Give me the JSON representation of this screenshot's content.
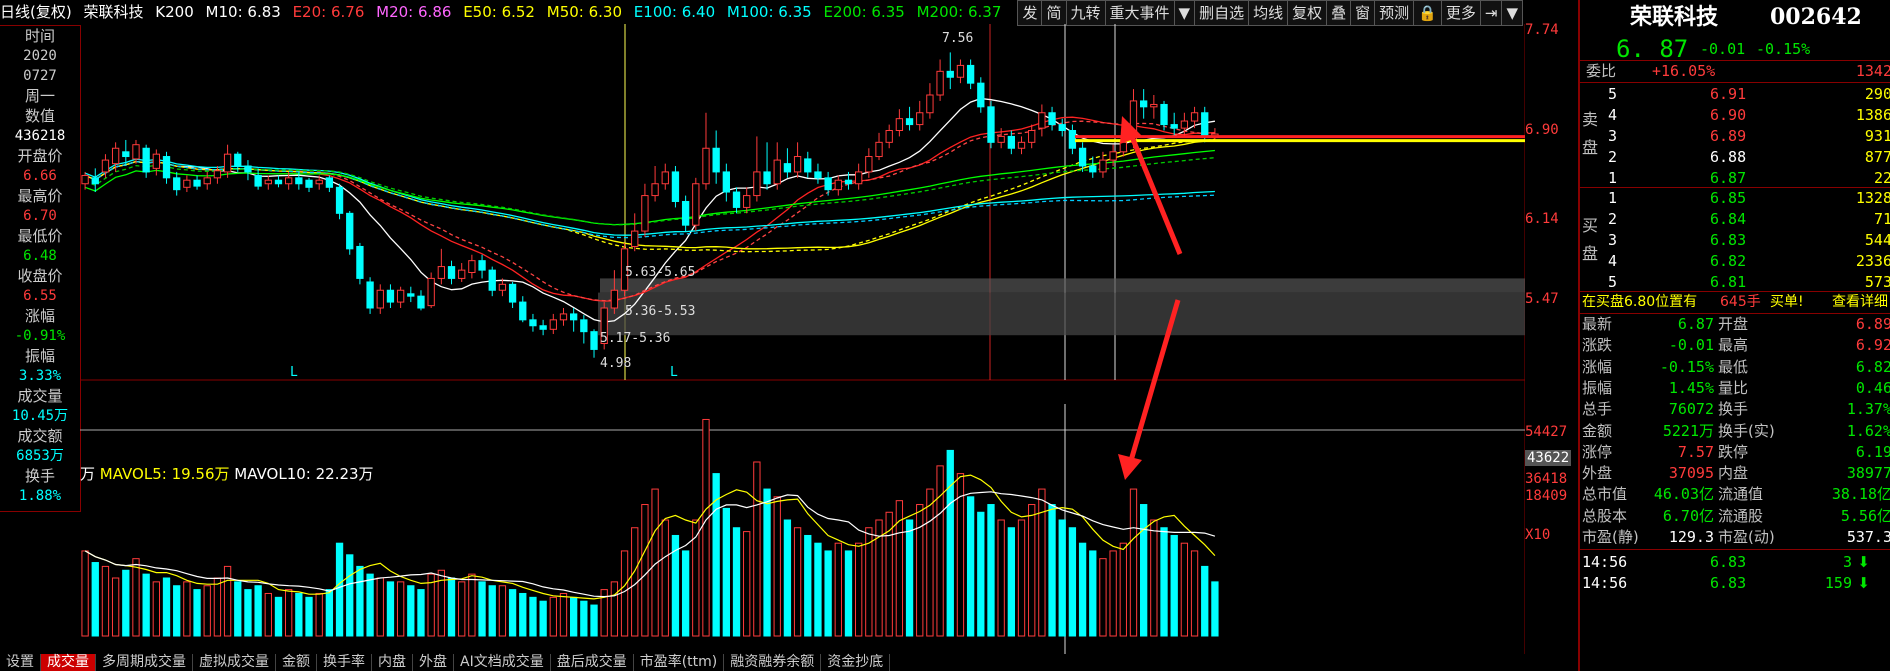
{
  "legend": {
    "title": "日线(复权)",
    "stock": "荣联科技",
    "k200": "K200",
    "m10": "M10: 6.83",
    "e20": "E20: 6.76",
    "m20": "M20: 6.86",
    "e50": "E50: 6.52",
    "m50": "M50: 6.30",
    "e100": "E100: 6.40",
    "m100": "M100: 6.35",
    "e200": "E200: 6.35",
    "m200": "M200: 6.37"
  },
  "toolbar": [
    "发",
    "简",
    "九转",
    "重大事件",
    "▼",
    "删自选",
    "均线",
    "复权",
    "叠",
    "窗",
    "预测",
    "🔒",
    "更多",
    "⇥",
    "▼"
  ],
  "left_panel": [
    {
      "label": "时间",
      "value": "2020"
    },
    {
      "label": "",
      "value": "0727"
    },
    {
      "label": "周一",
      "value": ""
    },
    {
      "label": "数值",
      "value": "436218"
    },
    {
      "label": "开盘价",
      "value": "6.66"
    },
    {
      "label": "最高价",
      "value": "6.70"
    },
    {
      "label": "最低价",
      "value": "6.48"
    },
    {
      "label": "收盘价",
      "value": "6.55"
    },
    {
      "label": "涨幅",
      "value": "-0.91%"
    },
    {
      "label": "振幅",
      "value": "3.33%"
    },
    {
      "label": "成交量",
      "value": "10.45万"
    },
    {
      "label": "成交额",
      "value": "6853万"
    },
    {
      "label": "换手",
      "value": "1.88%"
    }
  ],
  "price_scale": [
    "7.74",
    "6.90",
    "6.14",
    "5.47"
  ],
  "volume_scale": [
    "54427",
    "43622",
    "36418",
    "18409",
    "X10"
  ],
  "annotations": {
    "high": "7.56",
    "low": "4.98",
    "box1": "5.63-5.65",
    "box2": "5.36-5.53",
    "box3": "5.17-5.36",
    "l1": "L",
    "l2": "L"
  },
  "volume_legend": {
    "unit": "万",
    "mavol5": "MAVOL5: 19.56万",
    "mavol10": "MAVOL10: 22.23万"
  },
  "quote": {
    "name": "荣联科技",
    "code": "002642",
    "price": "6. 87",
    "change": "-0.01",
    "pct": "-0.15%",
    "weibi_label": "委比",
    "weibi_value": "+16.05%",
    "weibi_right": "1342",
    "sell_label_1": "卖",
    "sell_label_2": "盘",
    "buy_label_1": "买",
    "buy_label_2": "盘",
    "sells": [
      {
        "n": "5",
        "p": "6.91",
        "v": "290"
      },
      {
        "n": "4",
        "p": "6.90",
        "v": "1386"
      },
      {
        "n": "3",
        "p": "6.89",
        "v": "931"
      },
      {
        "n": "2",
        "p": "6.88",
        "v": "877"
      },
      {
        "n": "1",
        "p": "6.87",
        "v": "22"
      }
    ],
    "buys": [
      {
        "n": "1",
        "p": "6.85",
        "v": "1328"
      },
      {
        "n": "2",
        "p": "6.84",
        "v": "71"
      },
      {
        "n": "3",
        "p": "6.83",
        "v": "544"
      },
      {
        "n": "4",
        "p": "6.82",
        "v": "2336"
      },
      {
        "n": "5",
        "p": "6.81",
        "v": "573"
      }
    ],
    "notice_pre": "在买盘6.80位置有",
    "notice_amt": "645手",
    "notice_post": "买单!",
    "notice_link": "查看详细",
    "stats": [
      {
        "l": "最新",
        "v": "6.87",
        "l2": "开盘",
        "v2": "6.89"
      },
      {
        "l": "涨跌",
        "v": "-0.01",
        "l2": "最高",
        "v2": "6.92"
      },
      {
        "l": "涨幅",
        "v": "-0.15%",
        "l2": "最低",
        "v2": "6.82"
      },
      {
        "l": "振幅",
        "v": "1.45%",
        "l2": "量比",
        "v2": "0.46"
      },
      {
        "l": "总手",
        "v": "76072",
        "l2": "换手",
        "v2": "1.37%"
      },
      {
        "l": "金额",
        "v": "5221万",
        "l2": "换手(实)",
        "v2": "1.62%"
      },
      {
        "l": "涨停",
        "v": "7.57",
        "l2": "跌停",
        "v2": "6.19"
      },
      {
        "l": "外盘",
        "v": "37095",
        "l2": "内盘",
        "v2": "38977"
      },
      {
        "l": "总市值",
        "v": "46.03亿",
        "l2": "流通值",
        "v2": "38.18亿"
      },
      {
        "l": "总股本",
        "v": "6.70亿",
        "l2": "流通股",
        "v2": "5.56亿"
      },
      {
        "l": "市盈(静)",
        "v": "129.3",
        "l2": "市盈(动)",
        "v2": "537.3"
      }
    ],
    "ticks": [
      {
        "t": "14:56",
        "p": "6.83",
        "v": "3"
      },
      {
        "t": "14:56",
        "p": "6.83",
        "v": "159"
      }
    ]
  },
  "bottom_tabs": [
    "设置",
    "成交量",
    "多周期成交量",
    "虚拟成交量",
    "金额",
    "换手率",
    "内盘",
    "外盘",
    "AI文档成交量",
    "盘后成交量",
    "市盈率(ttm)",
    "融资融券余额",
    "资金抄底"
  ],
  "chart_data": {
    "type": "candlestick",
    "ylim": [
      4.8,
      7.8
    ],
    "candles": [
      [
        6.45,
        6.52,
        6.4,
        6.55
      ],
      [
        6.5,
        6.45,
        6.38,
        6.58
      ],
      [
        6.55,
        6.65,
        6.5,
        6.7
      ],
      [
        6.62,
        6.75,
        6.55,
        6.8
      ],
      [
        6.72,
        6.68,
        6.6,
        6.82
      ],
      [
        6.66,
        6.78,
        6.62,
        6.82
      ],
      [
        6.75,
        6.55,
        6.5,
        6.78
      ],
      [
        6.58,
        6.7,
        6.52,
        6.74
      ],
      [
        6.68,
        6.5,
        6.45,
        6.72
      ],
      [
        6.5,
        6.4,
        6.35,
        6.55
      ],
      [
        6.42,
        6.48,
        6.38,
        6.52
      ],
      [
        6.48,
        6.43,
        6.4,
        6.52
      ],
      [
        6.45,
        6.5,
        6.4,
        6.55
      ],
      [
        6.5,
        6.56,
        6.45,
        6.6
      ],
      [
        6.55,
        6.7,
        6.5,
        6.78
      ],
      [
        6.7,
        6.6,
        6.55,
        6.72
      ],
      [
        6.6,
        6.55,
        6.48,
        6.65
      ],
      [
        6.52,
        6.43,
        6.4,
        6.58
      ],
      [
        6.45,
        6.48,
        6.4,
        6.52
      ],
      [
        6.48,
        6.45,
        6.42,
        6.52
      ],
      [
        6.45,
        6.5,
        6.4,
        6.55
      ],
      [
        6.5,
        6.45,
        6.4,
        6.55
      ],
      [
        6.48,
        6.42,
        6.38,
        6.5
      ],
      [
        6.45,
        6.48,
        6.4,
        6.52
      ],
      [
        6.5,
        6.42,
        6.38,
        6.52
      ],
      [
        6.42,
        6.2,
        6.15,
        6.45
      ],
      [
        6.2,
        5.9,
        5.85,
        6.22
      ],
      [
        5.92,
        5.65,
        5.6,
        5.95
      ],
      [
        5.62,
        5.4,
        5.35,
        5.66
      ],
      [
        5.4,
        5.55,
        5.35,
        5.6
      ],
      [
        5.55,
        5.45,
        5.4,
        5.6
      ],
      [
        5.45,
        5.55,
        5.4,
        5.58
      ],
      [
        5.52,
        5.5,
        5.45,
        5.58
      ],
      [
        5.5,
        5.4,
        5.38,
        5.55
      ],
      [
        5.42,
        5.65,
        5.4,
        5.7
      ],
      [
        5.65,
        5.75,
        5.6,
        5.9
      ],
      [
        5.75,
        5.65,
        5.6,
        5.8
      ],
      [
        5.65,
        5.72,
        5.62,
        5.78
      ],
      [
        5.7,
        5.8,
        5.65,
        5.85
      ],
      [
        5.8,
        5.72,
        5.65,
        5.85
      ],
      [
        5.72,
        5.55,
        5.5,
        5.75
      ],
      [
        5.55,
        5.6,
        5.5,
        5.65
      ],
      [
        5.6,
        5.45,
        5.4,
        5.62
      ],
      [
        5.45,
        5.3,
        5.28,
        5.5
      ],
      [
        5.3,
        5.25,
        5.2,
        5.35
      ],
      [
        5.25,
        5.22,
        5.17,
        5.3
      ],
      [
        5.22,
        5.3,
        5.18,
        5.35
      ],
      [
        5.3,
        5.35,
        5.25,
        5.4
      ],
      [
        5.35,
        5.3,
        5.2,
        5.4
      ],
      [
        5.3,
        5.2,
        5.1,
        5.34
      ],
      [
        5.2,
        5.05,
        4.98,
        5.22
      ],
      [
        5.1,
        5.4,
        5.05,
        5.45
      ],
      [
        5.4,
        5.55,
        5.35,
        5.72
      ],
      [
        5.55,
        5.9,
        5.5,
        5.95
      ],
      [
        5.92,
        6.05,
        5.88,
        6.2
      ],
      [
        6.05,
        6.35,
        6.0,
        6.45
      ],
      [
        6.35,
        6.45,
        6.3,
        6.6
      ],
      [
        6.45,
        6.55,
        6.4,
        6.62
      ],
      [
        6.55,
        6.3,
        6.25,
        6.6
      ],
      [
        6.3,
        6.1,
        6.05,
        6.35
      ],
      [
        6.1,
        6.45,
        6.05,
        6.5
      ],
      [
        6.45,
        6.75,
        6.4,
        7.05
      ],
      [
        6.75,
        6.55,
        6.45,
        6.9
      ],
      [
        6.55,
        6.38,
        6.3,
        6.62
      ],
      [
        6.38,
        6.25,
        6.2,
        6.42
      ],
      [
        6.25,
        6.35,
        6.2,
        6.42
      ],
      [
        6.35,
        6.55,
        6.3,
        6.85
      ],
      [
        6.55,
        6.45,
        6.4,
        6.8
      ],
      [
        6.45,
        6.65,
        6.4,
        6.8
      ],
      [
        6.62,
        6.55,
        6.5,
        6.75
      ],
      [
        6.55,
        6.68,
        6.5,
        6.8
      ],
      [
        6.66,
        6.55,
        6.5,
        6.72
      ],
      [
        6.55,
        6.5,
        6.45,
        6.62
      ],
      [
        6.5,
        6.4,
        6.35,
        6.55
      ],
      [
        6.4,
        6.48,
        6.35,
        6.52
      ],
      [
        6.48,
        6.45,
        6.4,
        6.55
      ],
      [
        6.45,
        6.55,
        6.4,
        6.62
      ],
      [
        6.55,
        6.68,
        6.5,
        6.75
      ],
      [
        6.68,
        6.8,
        6.65,
        6.88
      ],
      [
        6.8,
        6.9,
        6.75,
        6.95
      ],
      [
        6.9,
        7.0,
        6.85,
        7.08
      ],
      [
        7.0,
        6.95,
        6.9,
        7.1
      ],
      [
        6.95,
        7.05,
        6.9,
        7.15
      ],
      [
        7.05,
        7.2,
        7.0,
        7.3
      ],
      [
        7.2,
        7.4,
        7.15,
        7.5
      ],
      [
        7.4,
        7.35,
        7.25,
        7.56
      ],
      [
        7.35,
        7.45,
        7.3,
        7.5
      ],
      [
        7.45,
        7.3,
        7.25,
        7.5
      ],
      [
        7.3,
        7.1,
        7.05,
        7.35
      ],
      [
        7.1,
        6.8,
        6.75,
        7.15
      ],
      [
        6.8,
        6.85,
        6.75,
        6.92
      ],
      [
        6.85,
        6.75,
        6.7,
        6.9
      ],
      [
        6.75,
        6.8,
        6.7,
        6.85
      ],
      [
        6.8,
        6.9,
        6.75,
        6.95
      ],
      [
        6.92,
        7.05,
        6.85,
        7.12
      ],
      [
        7.05,
        6.95,
        6.9,
        7.1
      ],
      [
        6.95,
        6.9,
        6.85,
        7.0
      ],
      [
        6.9,
        6.75,
        6.7,
        6.95
      ],
      [
        6.75,
        6.6,
        6.55,
        6.8
      ],
      [
        6.6,
        6.55,
        6.5,
        6.68
      ],
      [
        6.55,
        6.65,
        6.5,
        6.72
      ],
      [
        6.65,
        6.72,
        6.6,
        6.78
      ],
      [
        6.72,
        6.8,
        6.68,
        6.85
      ],
      [
        6.8,
        7.15,
        6.75,
        7.25
      ],
      [
        7.15,
        7.1,
        7.0,
        7.25
      ],
      [
        7.1,
        7.12,
        7.0,
        7.2
      ],
      [
        7.12,
        6.95,
        6.9,
        7.15
      ],
      [
        6.95,
        6.92,
        6.85,
        7.05
      ],
      [
        6.92,
        6.98,
        6.85,
        7.05
      ],
      [
        6.98,
        7.05,
        6.92,
        7.1
      ],
      [
        7.05,
        6.85,
        6.8,
        7.1
      ],
      [
        6.85,
        6.87,
        6.82,
        6.92
      ]
    ],
    "volumes": [
      [
        22,
        1
      ],
      [
        19,
        0
      ],
      [
        18,
        1
      ],
      [
        15,
        1
      ],
      [
        17,
        0
      ],
      [
        20,
        1
      ],
      [
        16,
        0
      ],
      [
        14,
        1
      ],
      [
        15,
        0
      ],
      [
        13,
        0
      ],
      [
        14,
        1
      ],
      [
        12,
        0
      ],
      [
        13,
        1
      ],
      [
        15,
        1
      ],
      [
        18,
        1
      ],
      [
        14,
        0
      ],
      [
        12,
        0
      ],
      [
        13,
        0
      ],
      [
        11,
        1
      ],
      [
        10,
        0
      ],
      [
        12,
        1
      ],
      [
        11,
        0
      ],
      [
        10,
        0
      ],
      [
        11,
        1
      ],
      [
        12,
        0
      ],
      [
        24,
        0
      ],
      [
        21,
        0
      ],
      [
        18,
        0
      ],
      [
        16,
        0
      ],
      [
        15,
        1
      ],
      [
        14,
        0
      ],
      [
        14,
        1
      ],
      [
        13,
        0
      ],
      [
        12,
        0
      ],
      [
        16,
        1
      ],
      [
        17,
        1
      ],
      [
        15,
        0
      ],
      [
        14,
        1
      ],
      [
        16,
        1
      ],
      [
        14,
        0
      ],
      [
        13,
        0
      ],
      [
        13,
        1
      ],
      [
        12,
        0
      ],
      [
        11,
        0
      ],
      [
        10,
        0
      ],
      [
        9,
        0
      ],
      [
        10,
        1
      ],
      [
        11,
        1
      ],
      [
        10,
        0
      ],
      [
        9,
        0
      ],
      [
        8,
        0
      ],
      [
        12,
        1
      ],
      [
        14,
        1
      ],
      [
        22,
        1
      ],
      [
        28,
        1
      ],
      [
        34,
        1
      ],
      [
        38,
        1
      ],
      [
        30,
        1
      ],
      [
        26,
        0
      ],
      [
        22,
        0
      ],
      [
        30,
        1
      ],
      [
        56,
        1
      ],
      [
        42,
        0
      ],
      [
        33,
        0
      ],
      [
        28,
        0
      ],
      [
        27,
        1
      ],
      [
        45,
        1
      ],
      [
        38,
        0
      ],
      [
        36,
        1
      ],
      [
        30,
        0
      ],
      [
        28,
        1
      ],
      [
        26,
        0
      ],
      [
        24,
        0
      ],
      [
        22,
        0
      ],
      [
        24,
        1
      ],
      [
        22,
        0
      ],
      [
        24,
        1
      ],
      [
        28,
        1
      ],
      [
        30,
        1
      ],
      [
        32,
        1
      ],
      [
        35,
        1
      ],
      [
        30,
        0
      ],
      [
        34,
        1
      ],
      [
        38,
        1
      ],
      [
        44,
        1
      ],
      [
        48,
        0
      ],
      [
        42,
        1
      ],
      [
        36,
        0
      ],
      [
        32,
        0
      ],
      [
        34,
        0
      ],
      [
        30,
        1
      ],
      [
        28,
        0
      ],
      [
        30,
        1
      ],
      [
        34,
        1
      ],
      [
        38,
        1
      ],
      [
        34,
        0
      ],
      [
        30,
        0
      ],
      [
        28,
        0
      ],
      [
        24,
        0
      ],
      [
        22,
        0
      ],
      [
        20,
        1
      ],
      [
        22,
        1
      ],
      [
        24,
        1
      ],
      [
        38,
        1
      ],
      [
        34,
        0
      ],
      [
        30,
        1
      ],
      [
        28,
        0
      ],
      [
        26,
        0
      ],
      [
        24,
        1
      ],
      [
        22,
        1
      ],
      [
        18,
        0
      ],
      [
        14,
        0
      ]
    ]
  }
}
